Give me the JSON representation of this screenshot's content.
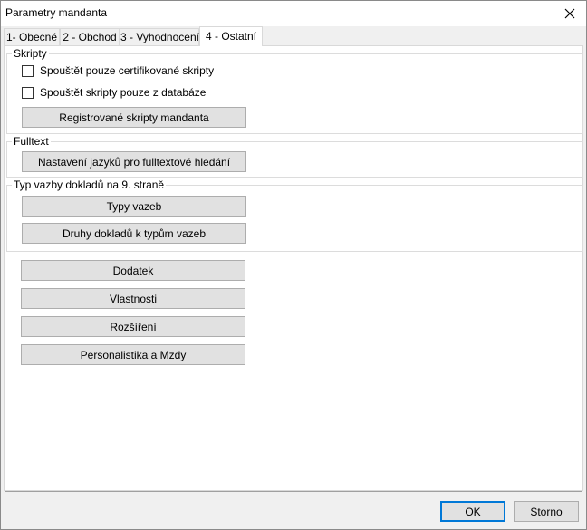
{
  "window": {
    "title": "Parametry mandanta"
  },
  "tabs": [
    {
      "label": "1- Obecné"
    },
    {
      "label": "2 - Obchod"
    },
    {
      "label": "3 - Vyhodnocení"
    },
    {
      "label": "4 - Ostatní",
      "active": true
    }
  ],
  "skripty": {
    "label": "Skripty",
    "checkbox_certified": {
      "label": "Spouštět pouze certifikované skripty",
      "checked": false
    },
    "checkbox_database": {
      "label": "Spouštět skripty pouze z databáze",
      "checked": false
    },
    "registered_button": "Registrované skripty mandanta"
  },
  "fulltext": {
    "label": "Fulltext",
    "languages_button": "Nastavení jazyků pro fulltextové hledání"
  },
  "vazby": {
    "label": "Typ vazby dokladů na 9. straně",
    "types_button": "Typy vazeb",
    "doc_types_button": "Druhy dokladů k typům vazeb"
  },
  "other_buttons": {
    "dodatek": "Dodatek",
    "vlastnosti": "Vlastnosti",
    "rozsireni": "Rozšíření",
    "personalistika": "Personalistika a Mzdy"
  },
  "footer": {
    "ok": "OK",
    "cancel": "Storno"
  },
  "icons": {
    "close": "close-icon"
  }
}
